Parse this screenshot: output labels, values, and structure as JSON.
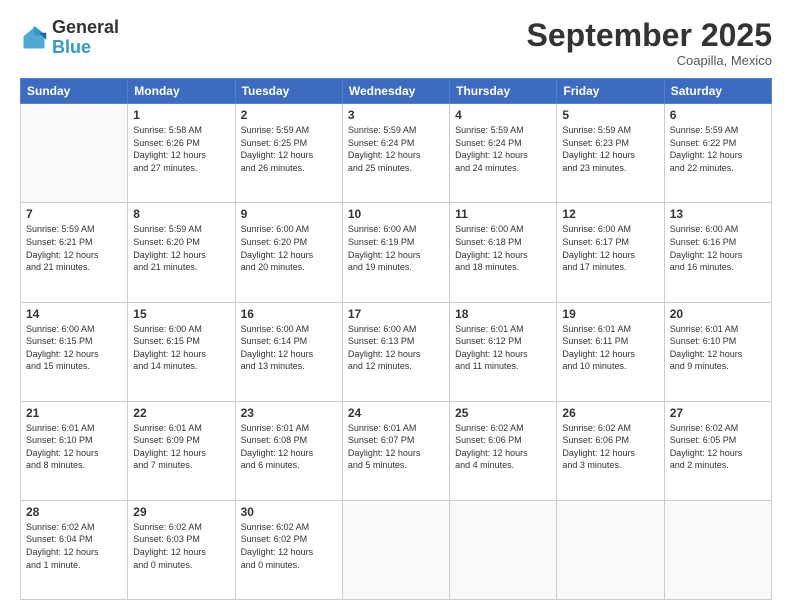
{
  "logo": {
    "general": "General",
    "blue": "Blue"
  },
  "header": {
    "month": "September 2025",
    "location": "Coapilla, Mexico"
  },
  "weekdays": [
    "Sunday",
    "Monday",
    "Tuesday",
    "Wednesday",
    "Thursday",
    "Friday",
    "Saturday"
  ],
  "weeks": [
    [
      {
        "day": "",
        "info": ""
      },
      {
        "day": "1",
        "info": "Sunrise: 5:58 AM\nSunset: 6:26 PM\nDaylight: 12 hours\nand 27 minutes."
      },
      {
        "day": "2",
        "info": "Sunrise: 5:59 AM\nSunset: 6:25 PM\nDaylight: 12 hours\nand 26 minutes."
      },
      {
        "day": "3",
        "info": "Sunrise: 5:59 AM\nSunset: 6:24 PM\nDaylight: 12 hours\nand 25 minutes."
      },
      {
        "day": "4",
        "info": "Sunrise: 5:59 AM\nSunset: 6:24 PM\nDaylight: 12 hours\nand 24 minutes."
      },
      {
        "day": "5",
        "info": "Sunrise: 5:59 AM\nSunset: 6:23 PM\nDaylight: 12 hours\nand 23 minutes."
      },
      {
        "day": "6",
        "info": "Sunrise: 5:59 AM\nSunset: 6:22 PM\nDaylight: 12 hours\nand 22 minutes."
      }
    ],
    [
      {
        "day": "7",
        "info": "Sunrise: 5:59 AM\nSunset: 6:21 PM\nDaylight: 12 hours\nand 21 minutes."
      },
      {
        "day": "8",
        "info": "Sunrise: 5:59 AM\nSunset: 6:20 PM\nDaylight: 12 hours\nand 21 minutes."
      },
      {
        "day": "9",
        "info": "Sunrise: 6:00 AM\nSunset: 6:20 PM\nDaylight: 12 hours\nand 20 minutes."
      },
      {
        "day": "10",
        "info": "Sunrise: 6:00 AM\nSunset: 6:19 PM\nDaylight: 12 hours\nand 19 minutes."
      },
      {
        "day": "11",
        "info": "Sunrise: 6:00 AM\nSunset: 6:18 PM\nDaylight: 12 hours\nand 18 minutes."
      },
      {
        "day": "12",
        "info": "Sunrise: 6:00 AM\nSunset: 6:17 PM\nDaylight: 12 hours\nand 17 minutes."
      },
      {
        "day": "13",
        "info": "Sunrise: 6:00 AM\nSunset: 6:16 PM\nDaylight: 12 hours\nand 16 minutes."
      }
    ],
    [
      {
        "day": "14",
        "info": "Sunrise: 6:00 AM\nSunset: 6:15 PM\nDaylight: 12 hours\nand 15 minutes."
      },
      {
        "day": "15",
        "info": "Sunrise: 6:00 AM\nSunset: 6:15 PM\nDaylight: 12 hours\nand 14 minutes."
      },
      {
        "day": "16",
        "info": "Sunrise: 6:00 AM\nSunset: 6:14 PM\nDaylight: 12 hours\nand 13 minutes."
      },
      {
        "day": "17",
        "info": "Sunrise: 6:00 AM\nSunset: 6:13 PM\nDaylight: 12 hours\nand 12 minutes."
      },
      {
        "day": "18",
        "info": "Sunrise: 6:01 AM\nSunset: 6:12 PM\nDaylight: 12 hours\nand 11 minutes."
      },
      {
        "day": "19",
        "info": "Sunrise: 6:01 AM\nSunset: 6:11 PM\nDaylight: 12 hours\nand 10 minutes."
      },
      {
        "day": "20",
        "info": "Sunrise: 6:01 AM\nSunset: 6:10 PM\nDaylight: 12 hours\nand 9 minutes."
      }
    ],
    [
      {
        "day": "21",
        "info": "Sunrise: 6:01 AM\nSunset: 6:10 PM\nDaylight: 12 hours\nand 8 minutes."
      },
      {
        "day": "22",
        "info": "Sunrise: 6:01 AM\nSunset: 6:09 PM\nDaylight: 12 hours\nand 7 minutes."
      },
      {
        "day": "23",
        "info": "Sunrise: 6:01 AM\nSunset: 6:08 PM\nDaylight: 12 hours\nand 6 minutes."
      },
      {
        "day": "24",
        "info": "Sunrise: 6:01 AM\nSunset: 6:07 PM\nDaylight: 12 hours\nand 5 minutes."
      },
      {
        "day": "25",
        "info": "Sunrise: 6:02 AM\nSunset: 6:06 PM\nDaylight: 12 hours\nand 4 minutes."
      },
      {
        "day": "26",
        "info": "Sunrise: 6:02 AM\nSunset: 6:06 PM\nDaylight: 12 hours\nand 3 minutes."
      },
      {
        "day": "27",
        "info": "Sunrise: 6:02 AM\nSunset: 6:05 PM\nDaylight: 12 hours\nand 2 minutes."
      }
    ],
    [
      {
        "day": "28",
        "info": "Sunrise: 6:02 AM\nSunset: 6:04 PM\nDaylight: 12 hours\nand 1 minute."
      },
      {
        "day": "29",
        "info": "Sunrise: 6:02 AM\nSunset: 6:03 PM\nDaylight: 12 hours\nand 0 minutes."
      },
      {
        "day": "30",
        "info": "Sunrise: 6:02 AM\nSunset: 6:02 PM\nDaylight: 12 hours\nand 0 minutes."
      },
      {
        "day": "",
        "info": ""
      },
      {
        "day": "",
        "info": ""
      },
      {
        "day": "",
        "info": ""
      },
      {
        "day": "",
        "info": ""
      }
    ]
  ]
}
